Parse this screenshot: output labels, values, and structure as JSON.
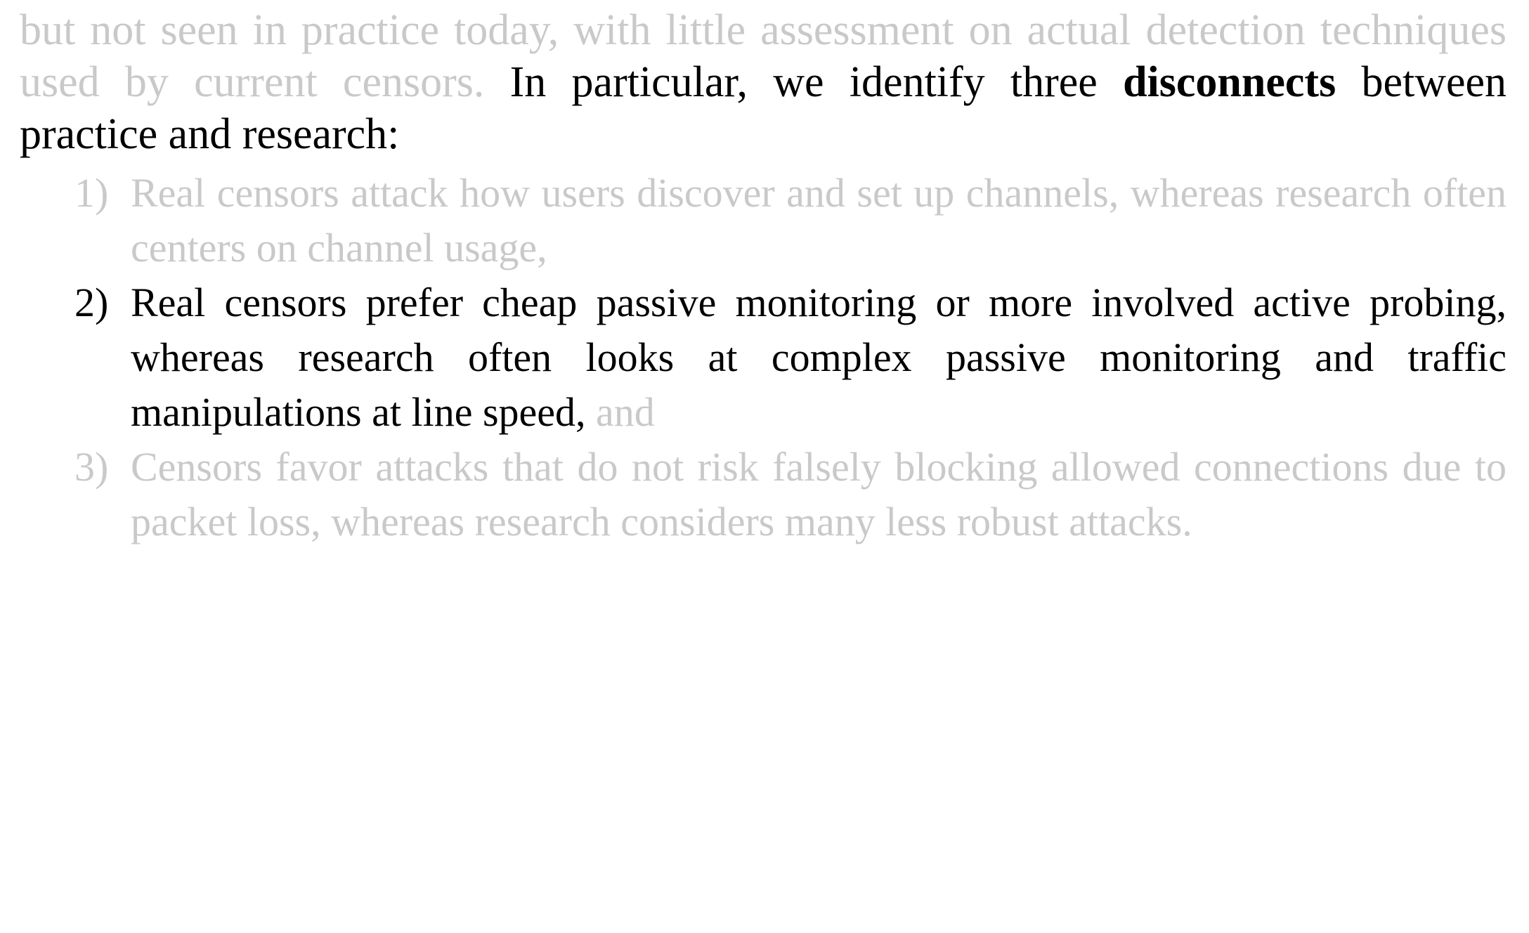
{
  "document": {
    "type": "paper-excerpt",
    "colors": {
      "background": "#ffffff",
      "emphasized_text": "#000000",
      "deemphasized_text": "#c9c9c9"
    },
    "paragraph": {
      "dim_prefix": "but not seen in practice today, with little assessment on actual detection techniques used by current censors.",
      "hot_part_1": " In particular, we identify three ",
      "hot_bold": "disconnects",
      "hot_part_2": " between practice and research:"
    },
    "list": {
      "items": [
        {
          "marker": "1)",
          "marker_state": "dim",
          "segments": [
            {
              "state": "dim",
              "text": "Real censors attack how users discover and set up channels, whereas research often centers on channel usage,"
            }
          ]
        },
        {
          "marker": "2)",
          "marker_state": "hot",
          "segments": [
            {
              "state": "hot",
              "text": "Real censors prefer cheap passive monitoring or more involved active probing, whereas research often looks at complex passive monitoring and traffic manipulations at line speed,"
            },
            {
              "state": "dim",
              "text": " and"
            }
          ]
        },
        {
          "marker": "3)",
          "marker_state": "dim",
          "segments": [
            {
              "state": "dim",
              "text": "Censors favor attacks that do not risk falsely blocking allowed connections due to packet loss, whereas research considers many less robust attacks."
            }
          ]
        }
      ]
    }
  }
}
